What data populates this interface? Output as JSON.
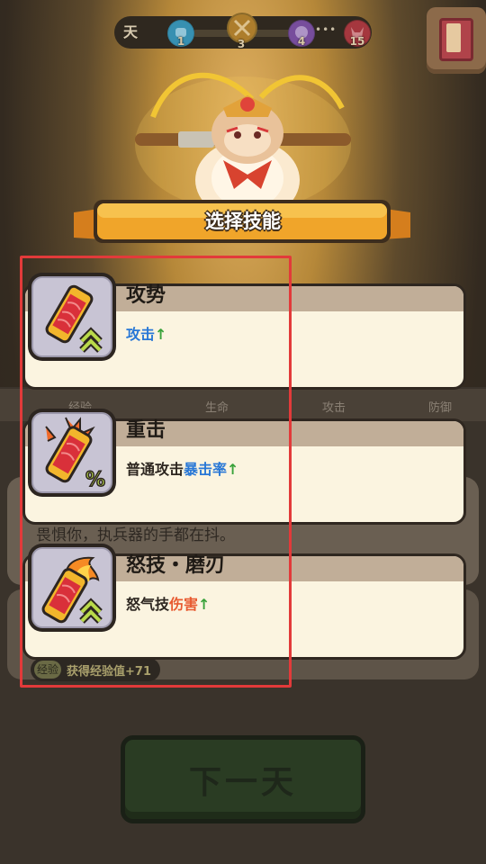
{
  "topbar": {
    "day_label": "天",
    "stages": [
      {
        "number": "1",
        "icon": "fist-stage-icon",
        "color": "#3ea0c4"
      },
      {
        "number": "3",
        "icon": "crossed-swords-stage-icon",
        "color": "#e0a23a"
      },
      {
        "number": "4",
        "icon": "skull-stage-icon",
        "color": "#8c5ab8"
      },
      {
        "number": "15",
        "icon": "demon-boss-stage-icon",
        "color": "#c9414a"
      }
    ],
    "ellipsis": "•••"
  },
  "book_icon": "skill-book-icon",
  "background": {
    "stat_labels": [
      "经验",
      "生命",
      "攻击",
      "防御"
    ],
    "story_text": "畏惧你，执兵器的手都在抖。",
    "exp_chip": "经验",
    "exp_gain": "获得经验值+71",
    "next_day_button": "下一天"
  },
  "dialog": {
    "title": "选择技能",
    "skills": [
      {
        "name": "攻势",
        "desc_plain": "",
        "desc_highlight": "攻击",
        "highlight_color": "#2877d6",
        "arrow": "↑",
        "icon": "attack-up-scroll-icon"
      },
      {
        "name": "重击",
        "desc_plain": "普通攻击",
        "desc_highlight": "暴击率",
        "highlight_color": "#2877d6",
        "arrow": "↑",
        "icon": "critical-rate-scroll-icon"
      },
      {
        "name": "怒技・磨刃",
        "desc_plain": "怒气技",
        "desc_highlight": "伤害",
        "highlight_color": "#e85a30",
        "arrow": "↑",
        "icon": "rage-damage-scroll-icon"
      }
    ]
  },
  "colors": {
    "card_bg": "#fbf4e0",
    "card_header": "#c1ae98",
    "banner": "#f0a52a",
    "highlight_frame": "#e23a3a"
  }
}
